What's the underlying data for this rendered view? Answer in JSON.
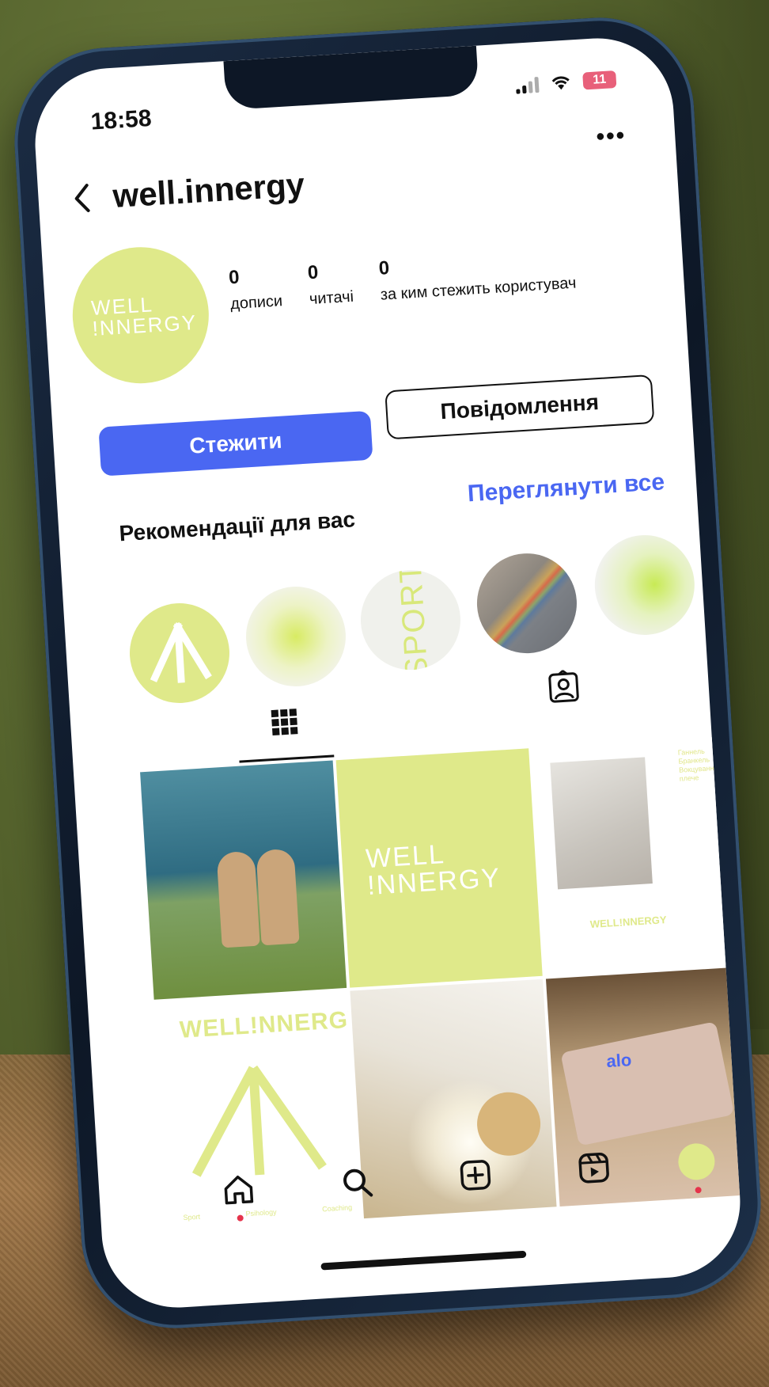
{
  "status": {
    "time": "18:58",
    "battery": "11"
  },
  "header": {
    "username": "well.innergy"
  },
  "profile": {
    "avatar_line1": "WELL",
    "avatar_line2": "!NNERGY",
    "stats": [
      {
        "num": "0",
        "label": "дописи"
      },
      {
        "num": "0",
        "label": "читачі"
      },
      {
        "num": "0",
        "label": "за ким стежить користувач"
      }
    ]
  },
  "actions": {
    "follow_label": "Стежити",
    "message_label": "Повідомлення"
  },
  "recommendations": {
    "title": "Рекомендації для вас",
    "see_all": "Переглянути все",
    "circle3_text": "SPORT"
  },
  "grid": {
    "post2_line1": "WELL",
    "post2_line2": "!NNERGY",
    "post3_brand": "WELL!NNERGY",
    "post3_side": "Ганнель Бранкель Вокцування плече",
    "post4_brand": "WELL!NNERGY",
    "post4_tags": [
      "Sport",
      "Psihology",
      "Coaching"
    ],
    "post6_logo": "alo"
  },
  "colors": {
    "accent": "#4a67f2",
    "brand_lime": "#dfe98a",
    "notification": "#e5334b"
  },
  "icons": {
    "back": "chevron-left-icon",
    "more": "more-dots-icon",
    "grid": "grid-icon",
    "tagged": "tagged-person-icon",
    "home": "home-icon",
    "search": "search-icon",
    "create": "plus-square-icon",
    "reels": "reels-icon"
  }
}
